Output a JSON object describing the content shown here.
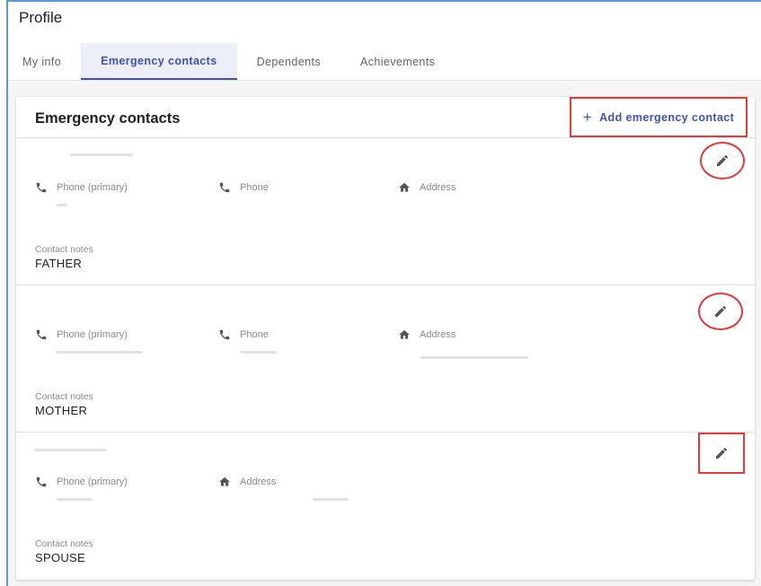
{
  "page": {
    "title": "Profile"
  },
  "tabs": [
    {
      "label": "My info"
    },
    {
      "label": "Emergency contacts"
    },
    {
      "label": "Dependents"
    },
    {
      "label": "Achievements"
    }
  ],
  "card": {
    "title": "Emergency contacts",
    "add_button": {
      "icon": "plus-icon",
      "label": "Add emergency contact"
    }
  },
  "contacts": [
    {
      "fields": [
        {
          "icon": "phone-icon",
          "label": "Phone (primary)"
        },
        {
          "icon": "phone-icon",
          "label": "Phone"
        },
        {
          "icon": "home-icon",
          "label": "Address"
        }
      ],
      "notes_label": "Contact notes",
      "notes_value": "FATHER"
    },
    {
      "fields": [
        {
          "icon": "phone-icon",
          "label": "Phone (primary)"
        },
        {
          "icon": "phone-icon",
          "label": "Phone"
        },
        {
          "icon": "home-icon",
          "label": "Address"
        }
      ],
      "notes_label": "Contact notes",
      "notes_value": "MOTHER"
    },
    {
      "fields": [
        {
          "icon": "phone-icon",
          "label": "Phone (primary)"
        },
        {
          "icon": "home-icon",
          "label": "Address"
        }
      ],
      "notes_label": "Contact notes",
      "notes_value": "SPOUSE"
    }
  ],
  "colors": {
    "accent": "#3f51b5",
    "highlight": "#e33a3a",
    "muted_text": "#8a8a8a"
  }
}
